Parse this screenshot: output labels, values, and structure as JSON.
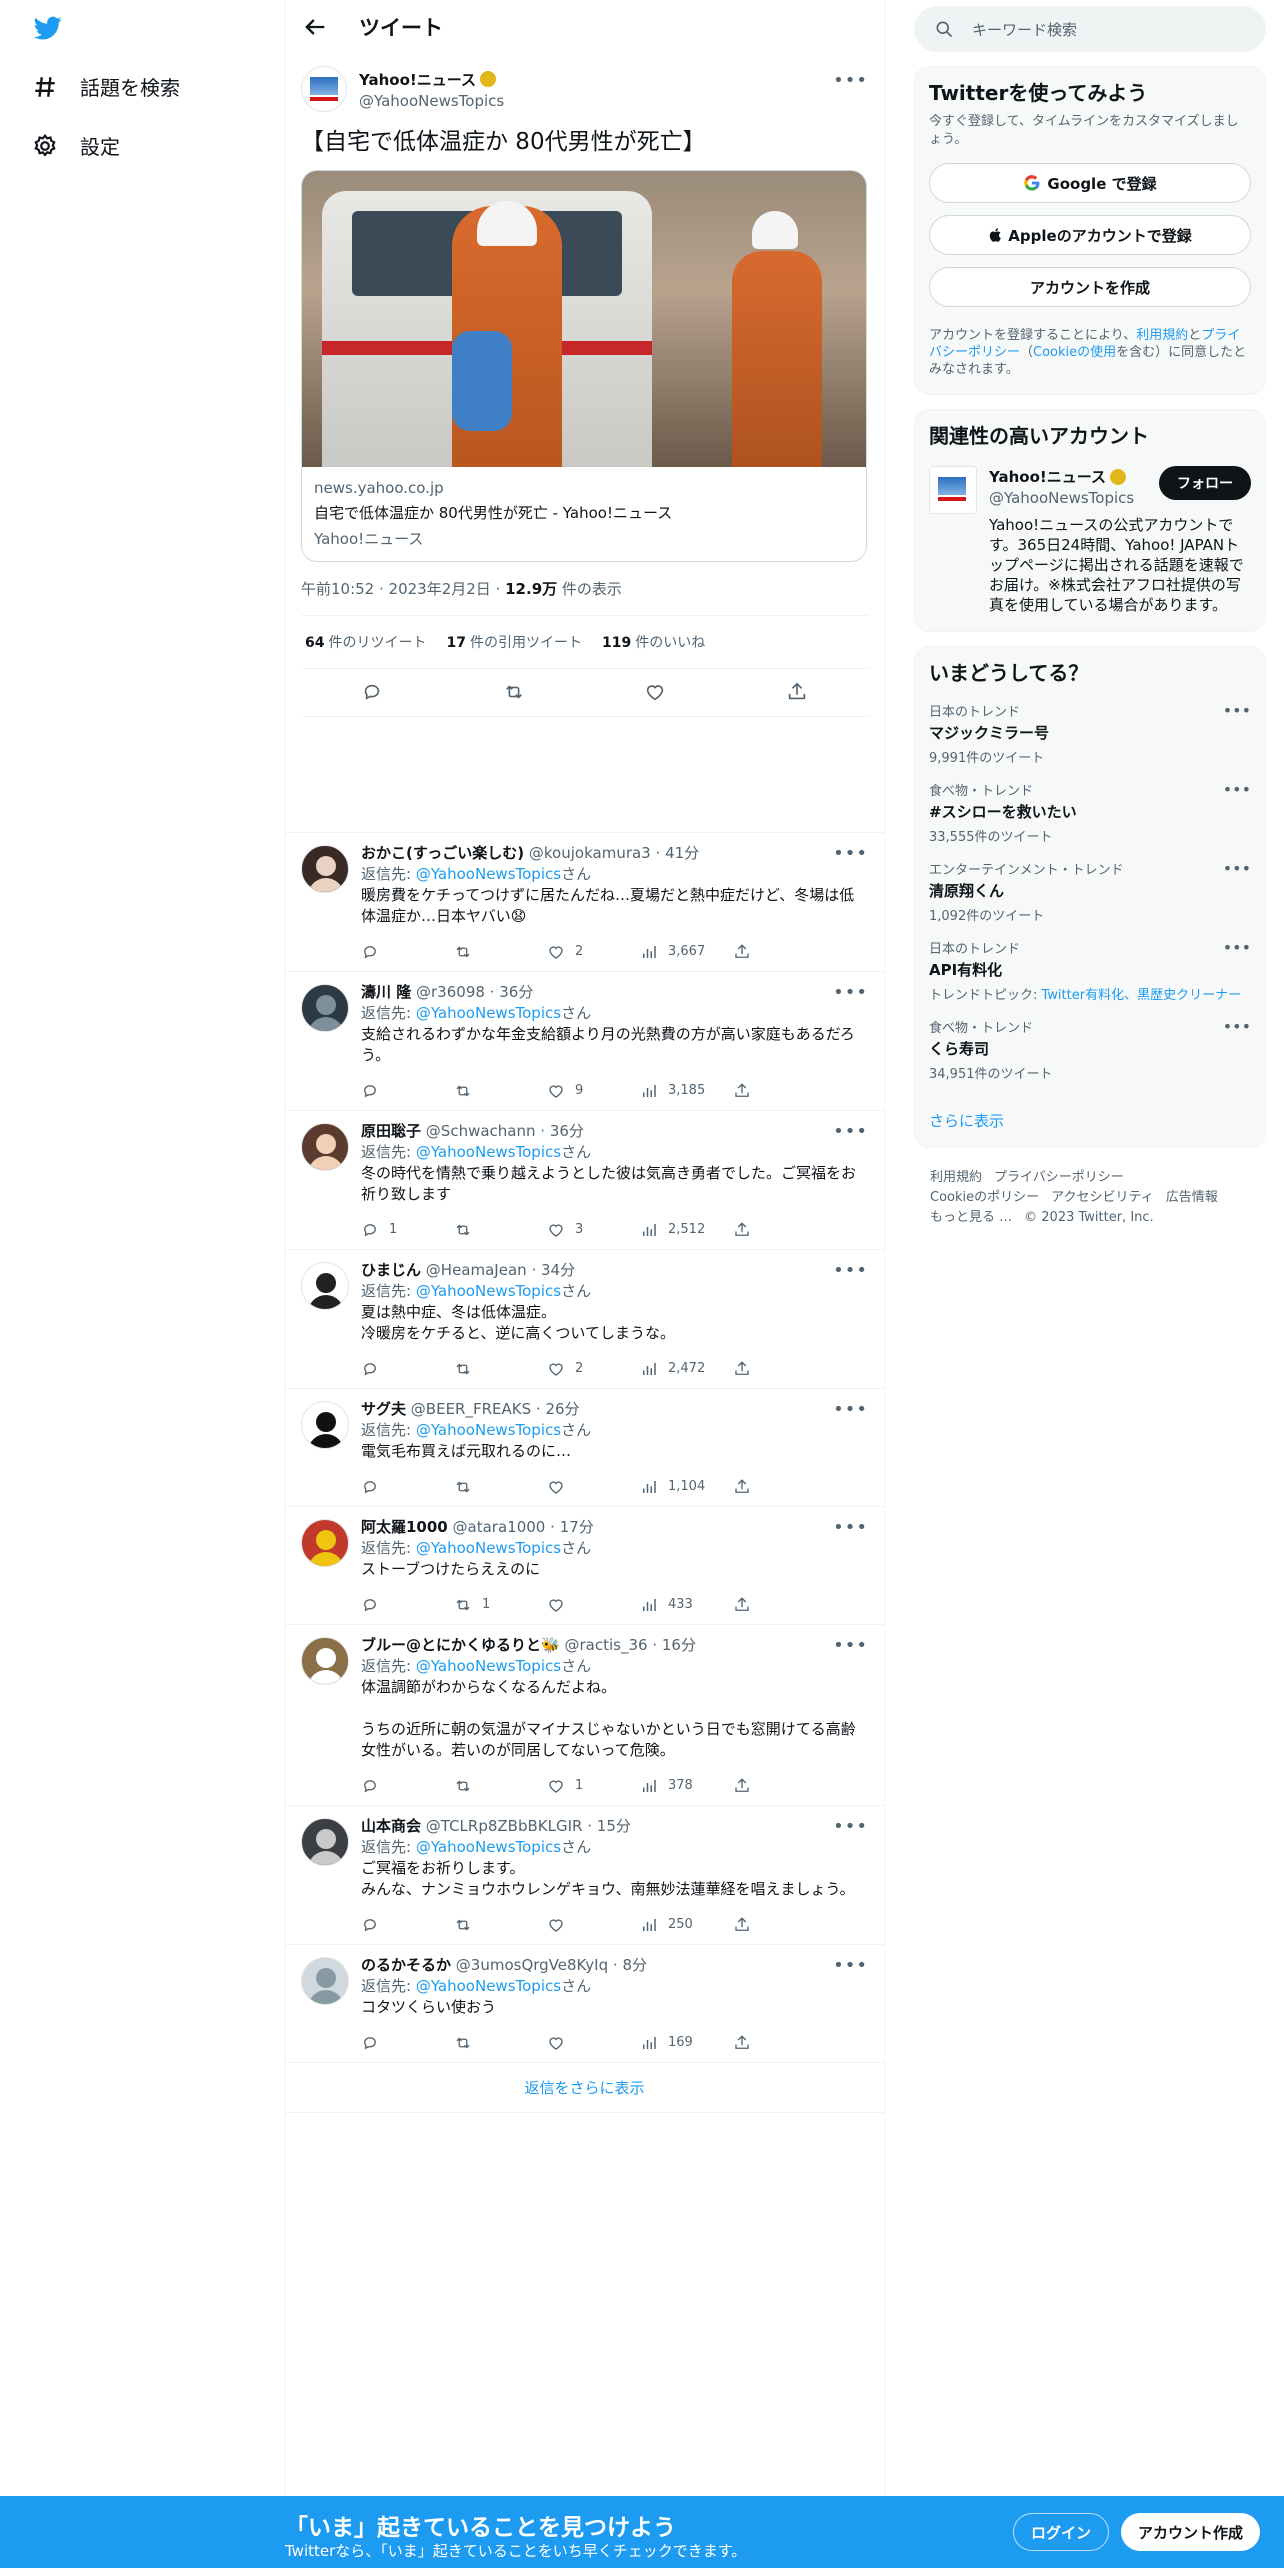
{
  "nav": {
    "explore_label": "話題を検索",
    "settings_label": "設定"
  },
  "header": {
    "title": "ツイート"
  },
  "tweet": {
    "author_name": "Yahoo!ニュース",
    "author_handle": "@YahooNewsTopics",
    "text": "【自宅で低体温症か 80代男性が死亡】",
    "card_domain": "news.yahoo.co.jp",
    "card_title": "自宅で低体温症か 80代男性が死亡 - Yahoo!ニュース",
    "card_source": "Yahoo!ニュース",
    "time": "午前10:52",
    "date": "2023年2月2日",
    "views_count": "12.9万",
    "views_label": "件の表示",
    "retweets_count": "64",
    "retweets_label": "件のリツイート",
    "quotes_count": "17",
    "quotes_label": "件の引用ツイート",
    "likes_count": "119",
    "likes_label": "件のいいね"
  },
  "reply_prefix": "返信先: ",
  "reply_to": "@YahooNewsTopics",
  "reply_suffix": "さん",
  "replies": [
    {
      "name": "おかこ(すっごい楽しむ)",
      "handle": "@koujokamura3",
      "time": "41分",
      "text": "暖房費をケチってつけずに居たんだね…夏場だと熱中症だけど、冬場は低体温症か…日本ヤバい😧",
      "replies": "",
      "retweets": "",
      "likes": "2",
      "views": "3,667"
    },
    {
      "name": "濤川 隆",
      "handle": "@r36098",
      "time": "36分",
      "text": "支給されるわずかな年金支給額より月の光熱費の方が高い家庭もあるだろう。",
      "replies": "",
      "retweets": "",
      "likes": "9",
      "views": "3,185"
    },
    {
      "name": "原田聡子",
      "handle": "@Schwachann",
      "time": "36分",
      "text": "冬の時代を情熱で乗り越えようとした彼は気高き勇者でした。ご冥福をお祈り致します",
      "replies": "1",
      "retweets": "",
      "likes": "3",
      "views": "2,512"
    },
    {
      "name": "ひまじん",
      "handle": "@HeamaJean",
      "time": "34分",
      "text": "夏は熱中症、冬は低体温症。\n冷暖房をケチると、逆に高くついてしまうな。",
      "replies": "",
      "retweets": "",
      "likes": "2",
      "views": "2,472"
    },
    {
      "name": "サグ夫",
      "handle": "@BEER_FREAKS",
      "time": "26分",
      "text": "電気毛布買えば元取れるのに…",
      "replies": "",
      "retweets": "",
      "likes": "",
      "views": "1,104"
    },
    {
      "name": "阿太羅1000",
      "handle": "@atara1000",
      "time": "17分",
      "text": "ストーブつけたらええのに",
      "replies": "",
      "retweets": "1",
      "likes": "",
      "views": "433"
    },
    {
      "name": "ブルー@とにかくゆるりと🐝",
      "handle": "@ractis_36",
      "time": "16分",
      "text": "体温調節がわからなくなるんだよね。\n\nうちの近所に朝の気温がマイナスじゃないかという日でも窓開けてる高齢女性がいる。若いのが同居してないって危険。",
      "replies": "",
      "retweets": "",
      "likes": "1",
      "views": "378"
    },
    {
      "name": "山本商会",
      "handle": "@TCLRp8ZBbBKLGIR",
      "time": "15分",
      "text": "ご冥福をお祈りします。\nみんな、ナンミョウホウレンゲキョウ、南無妙法蓮華経を唱えましょう。",
      "replies": "",
      "retweets": "",
      "likes": "",
      "views": "250"
    },
    {
      "name": "のるかそるか",
      "handle": "@3umosQrgVe8KyIq",
      "time": "8分",
      "text": "コタツくらい使おう",
      "replies": "",
      "retweets": "",
      "likes": "",
      "views": "169"
    }
  ],
  "show_more_replies": "返信をさらに表示",
  "sidebar": {
    "search_placeholder": "キーワード検索",
    "signup_title": "Twitterを使ってみよう",
    "signup_sub": "今すぐ登録して、タイムラインをカスタマイズしましょう。",
    "google_btn": "Google で登録",
    "apple_btn": "Appleのアカウントで登録",
    "create_btn": "アカウントを作成",
    "terms_1": "アカウントを登録することにより、",
    "terms_link1": "利用規約",
    "terms_2": "と",
    "terms_link2": "プライバシーポリシー",
    "terms_3": "（",
    "terms_link3": "Cookieの使用",
    "terms_4": "を含む）に同意したとみなされます。",
    "related_title": "関連性の高いアカウント",
    "acc_name": "Yahoo!ニュース",
    "acc_handle": "@YahooNewsTopics",
    "acc_follow": "フォロー",
    "acc_desc": "Yahoo!ニュースの公式アカウントです。365日24時間、Yahoo! JAPANトップページに掲出される話題を速報でお届け。※株式会社アフロ社提供の写真を使用している場合があります。",
    "trends_title": "いまどうしてる？",
    "trends": [
      {
        "cat": "日本のトレンド",
        "topic": "マジックミラー号",
        "count": "9,991件のツイート"
      },
      {
        "cat": "食べ物・トレンド",
        "topic": "#スシローを救いたい",
        "count": "33,555件のツイート"
      },
      {
        "cat": "エンターテインメント・トレンド",
        "topic": "清原翔くん",
        "count": "1,092件のツイート"
      },
      {
        "cat": "日本のトレンド",
        "topic": "API有料化",
        "count": "トレンドトピック: ",
        "links": "Twitter有料化、黒歴史クリーナー"
      },
      {
        "cat": "食べ物・トレンド",
        "topic": "くら寿司",
        "count": "34,951件のツイート"
      }
    ],
    "trends_more": "さらに表示",
    "footer": [
      "利用規約",
      "プライバシーポリシー",
      "Cookieのポリシー",
      "アクセシビリティ",
      "広告情報",
      "もっと見る …",
      "© 2023 Twitter, Inc."
    ]
  },
  "bottom": {
    "headline": "「いま」起きていることを見つけよう",
    "sub": "Twitterなら、「いま」起きていることをいち早くチェックできます。",
    "login": "ログイン",
    "signup": "アカウント作成"
  },
  "colors": {
    "accent": "#1d9bf0",
    "text": "#0f1419",
    "muted": "#536471"
  }
}
